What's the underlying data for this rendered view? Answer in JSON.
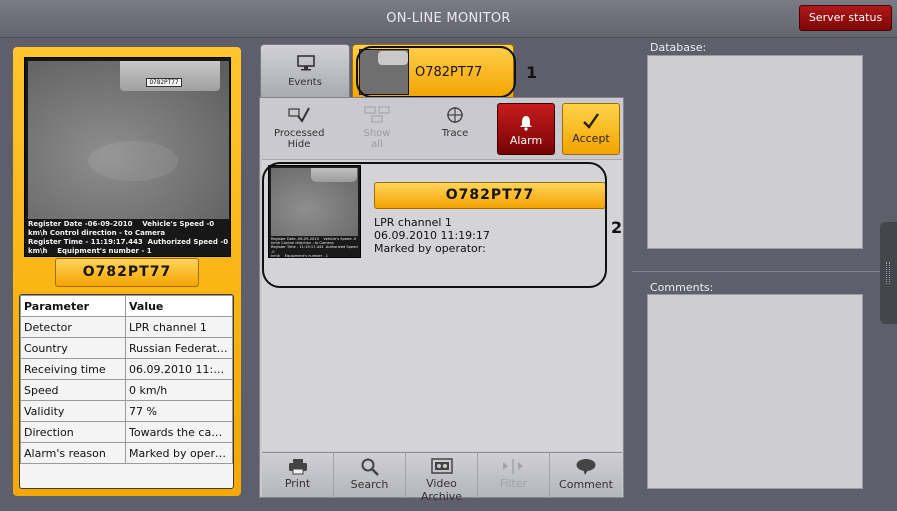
{
  "window": {
    "title": "ON-LINE MONITOR"
  },
  "header": {
    "server_status_label": "Server status"
  },
  "left_panel": {
    "camera_overlay": "Register Date -06-09-2010    Vehicle's Speed -0\nkm\\h Control direction - to Camera\nRegister Time - 11:19:17.443  Authorized Speed -0\nkm\\h    Equipment's number - 1",
    "car_plate_text": "O782PT77",
    "plate": "O782PT77",
    "table": {
      "headers": [
        "Parameter",
        "Value"
      ],
      "rows": [
        [
          "Detector",
          "LPR channel 1"
        ],
        [
          "Country",
          "Russian Federati..."
        ],
        [
          "Receiving time",
          "06.09.2010 11:1..."
        ],
        [
          "Speed",
          "0 km/h"
        ],
        [
          "Validity",
          "77 %"
        ],
        [
          "Direction",
          "Towards the cam..."
        ],
        [
          "Alarm's reason",
          "Marked by opera..."
        ]
      ]
    }
  },
  "tabs": {
    "events_label": "Events",
    "plate_tab_label": "O782PT77"
  },
  "annotations": {
    "one": "1",
    "two": "2"
  },
  "toolbar": {
    "processed_hide_label": "Processed\nHide",
    "show_all_label": "Show\nall",
    "trace_label": "Trace",
    "alarm_label": "Alarm",
    "accept_label": "Accept"
  },
  "event": {
    "thumb_overlay": "Register Date -06-09-2010    Vehicle's Speed -0\nkm\\h Control direction - to Camera\nRegister Time - 11:19:17.443  Authorized Speed -0\nkm\\h    Equipment's number - 1",
    "plate": "O782PT77",
    "channel": "LPR channel 1",
    "datetime": "06.09.2010 11:19:17",
    "marked": "Marked by operator:"
  },
  "bottom_bar": {
    "print_label": "Print",
    "search_label": "Search",
    "video_archive_label": "Video Archive",
    "filter_label": "Filter",
    "comment_label": "Comment"
  },
  "right_panel": {
    "database_label": "Database:",
    "comments_label": "Comments:"
  },
  "colors": {
    "accent_orange": "#f5a800",
    "alarm_red": "#a80f0f",
    "background": "#5f5f6b"
  }
}
